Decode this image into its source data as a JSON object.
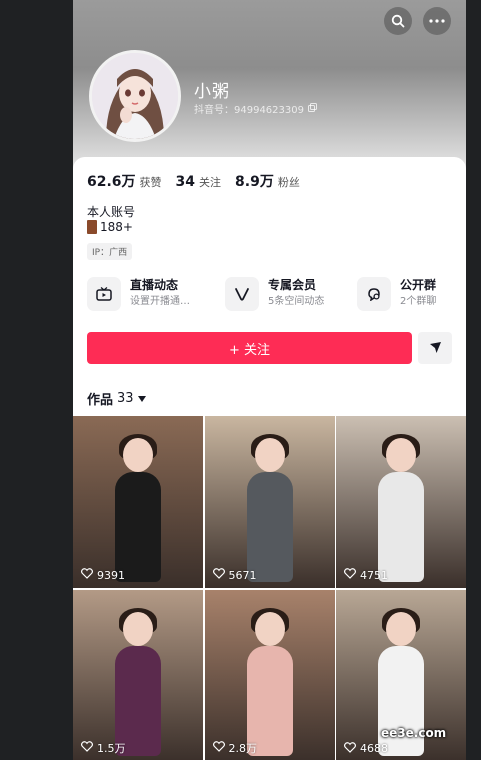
{
  "header": {
    "search_icon": "search-icon",
    "more_icon": "more-icon"
  },
  "profile": {
    "name": "小粥",
    "douyin_id": "抖音号：94994623309",
    "copy_icon": "copy-icon"
  },
  "stats": [
    {
      "value": "62.6万",
      "label": "获赞"
    },
    {
      "value": "34",
      "label": "关注"
    },
    {
      "value": "8.9万",
      "label": "粉丝"
    }
  ],
  "bio": {
    "line1": "本人账号",
    "line2": "188+",
    "ip": "IP：广西"
  },
  "features": [
    {
      "title": "直播动态",
      "subtitle": "设置开播通…",
      "icon": "live-icon"
    },
    {
      "title": "专属会员",
      "subtitle": "5条空间动态",
      "icon": "vip-icon"
    },
    {
      "title": "公开群",
      "subtitle": "2个群聊",
      "icon": "group-chat-icon"
    }
  ],
  "actions": {
    "follow_label": "+ 关注",
    "share_icon": "share-icon"
  },
  "works": {
    "label": "作品",
    "count": "33"
  },
  "videos": [
    {
      "likes": "9391",
      "bg": "#8a6a55",
      "outfit": "#1b1b1b"
    },
    {
      "likes": "5671",
      "bg": "#c9b6a0",
      "outfit": "#55595e"
    },
    {
      "likes": "4751",
      "bg": "#cbbfb2",
      "outfit": "#e8e8e8"
    },
    {
      "likes": "1.5万",
      "bg": "#b39a86",
      "outfit": "#5b2a4d"
    },
    {
      "likes": "2.8万",
      "bg": "#a8826b",
      "outfit": "#e7b5ad"
    },
    {
      "likes": "4688",
      "bg": "#b8a795",
      "outfit": "#f2f2f2"
    }
  ],
  "watermark": "ee3e.com",
  "colors": {
    "accent": "#fe2c55"
  }
}
